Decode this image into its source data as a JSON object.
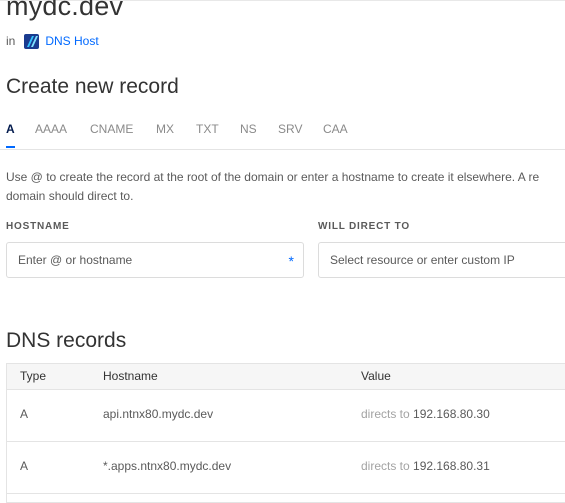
{
  "domain": {
    "name": "mydc.dev",
    "in_label": "in",
    "project_link": "DNS Host",
    "project_icon": "dns-host-project-icon"
  },
  "create_section": {
    "title": "Create new record",
    "tabs": [
      "A",
      "AAAA",
      "CNAME",
      "MX",
      "TXT",
      "NS",
      "SRV",
      "CAA"
    ],
    "active_tab": "A",
    "help_line1": "Use @ to create the record at the root of the domain or enter a hostname to create it elsewhere. A re",
    "help_line2": "domain should direct to.",
    "hostname_label": "HOSTNAME",
    "hostname_placeholder": "Enter @ or hostname",
    "required_mark": "*",
    "direct_label": "WILL DIRECT TO",
    "direct_placeholder": "Select resource or enter custom IP"
  },
  "records_section": {
    "title": "DNS records",
    "columns": [
      "Type",
      "Hostname",
      "Value"
    ],
    "rows": [
      {
        "type": "A",
        "hostname": "api.ntnx80.mydc.dev",
        "directs_to_label": "directs to",
        "value": "192.168.80.30"
      },
      {
        "type": "A",
        "hostname": "*.apps.ntnx80.mydc.dev",
        "directs_to_label": "directs to",
        "value": "192.168.80.31"
      }
    ]
  },
  "colors": {
    "accent": "#0069ff",
    "text": "#333333",
    "muted": "#a3a3a3",
    "border": "#e4e4e4",
    "header_bg": "#f6f6f6"
  }
}
